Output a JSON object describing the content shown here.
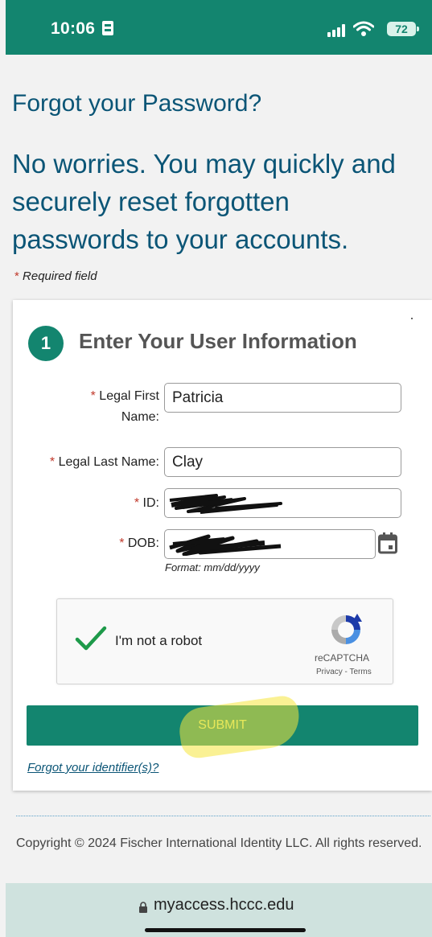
{
  "status_bar": {
    "time": "10:06",
    "battery": "72",
    "icons": [
      "sim-icon",
      "signal-icon",
      "wifi-icon",
      "battery-icon"
    ],
    "color": "#13856f"
  },
  "page": {
    "title": "Forgot your Password?",
    "subtitle": "No worries. You may quickly and securely reset forgotten passwords to your accounts.",
    "required_star": "*",
    "required_note": "Required field"
  },
  "form": {
    "step_number": "1",
    "step_title": "Enter Your User Information",
    "fields": {
      "first_name": {
        "label": "Legal First Name:",
        "value": "Patricia"
      },
      "last_name": {
        "label": "Legal Last Name:",
        "value": "Clay"
      },
      "id": {
        "label": "ID:",
        "value": ""
      },
      "dob": {
        "label": "DOB:",
        "value": "",
        "format_hint": "Format: mm/dd/yyyy"
      }
    },
    "captcha": {
      "label": "I'm not a robot",
      "brand": "reCAPTCHA",
      "links": "Privacy - Terms",
      "checked": true
    },
    "submit_label": "SUBMIT",
    "forgot_identifier_link": "Forgot your identifier(s)?"
  },
  "footer": {
    "copyright": "Copyright © 2024 Fischer International Identity LLC. All rights reserved."
  },
  "browser": {
    "url": "myaccess.hccc.edu"
  },
  "colors": {
    "accent": "#13856f",
    "heading": "#0b5576",
    "required": "#c0392b",
    "highlight": "#f5e63c"
  }
}
